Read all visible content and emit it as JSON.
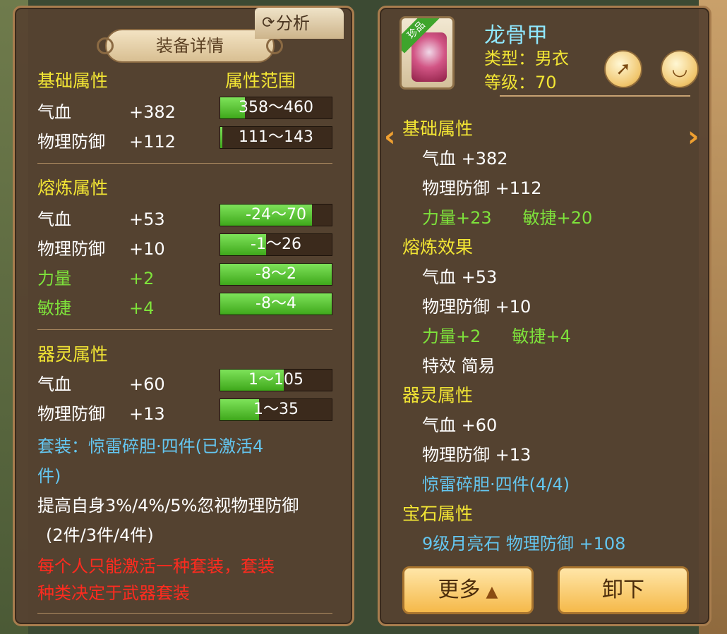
{
  "detail_panel": {
    "title": "装备详情",
    "analyze_label": "分析",
    "range_header": "属性范围",
    "base": {
      "header": "基础属性",
      "rows": [
        {
          "name": "气血",
          "value": "+382",
          "range": "358～460",
          "fill": 0.22
        },
        {
          "name": "物理防御",
          "value": "+112",
          "range": "111～143",
          "fill": 0.02
        }
      ]
    },
    "refine": {
      "header": "熔炼属性",
      "rows": [
        {
          "name": "气血",
          "value": "+53",
          "range": "-24～70",
          "fill": 0.82
        },
        {
          "name": "物理防御",
          "value": "+10",
          "range": "-1～26",
          "fill": 0.41
        },
        {
          "name": "力量",
          "value": "+2",
          "range": "-8～2",
          "fill": 1.0
        },
        {
          "name": "敏捷",
          "value": "+4",
          "range": "-8～4",
          "fill": 1.0
        }
      ]
    },
    "spirit": {
      "header": "器灵属性",
      "rows": [
        {
          "name": "气血",
          "value": "+60",
          "range": "1～105",
          "fill": 0.57
        },
        {
          "name": "物理防御",
          "value": "+13",
          "range": "1～35",
          "fill": 0.35
        }
      ]
    },
    "set_line1": "套装：惊雷碎胆·四件(已激活4",
    "set_line2": "件)",
    "set_desc_line1": "提高自身3%/4%/5%忽视物理防御",
    "set_desc_line2": "(2件/3件/4件)",
    "warn_line1": "每个人只能激活一种套装，套装",
    "warn_line2": "种类决定于武器套装"
  },
  "item_panel": {
    "rarity_badge": "珍品",
    "name": "龙骨甲",
    "type": "类型：男衣",
    "level": "等级：70",
    "share_icon": "share-icon",
    "eye_icon": "eye-icon",
    "base_header": "基础属性",
    "base_hp": "气血 +382",
    "base_def": "物理防御 +112",
    "base_str": "力量+23",
    "base_agi": "敏捷+20",
    "refine_header": "熔炼效果",
    "refine_hp": "气血 +53",
    "refine_def": "物理防御 +10",
    "refine_str": "力量+2",
    "refine_agi": "敏捷+4",
    "effect": "特效 简易",
    "spirit_header": "器灵属性",
    "spirit_hp": "气血 +60",
    "spirit_def": "物理防御 +13",
    "set_progress": "惊雷碎胆·四件(4/4)",
    "gem_header": "宝石属性",
    "gem_line": "9级月亮石 物理防御 +108",
    "more_label": "更多",
    "unload_label": "卸下"
  },
  "colors": {
    "yellow": "#f2e534",
    "green": "#7ee23b",
    "cyan": "#64c6f0",
    "red": "#ff2b1f"
  }
}
